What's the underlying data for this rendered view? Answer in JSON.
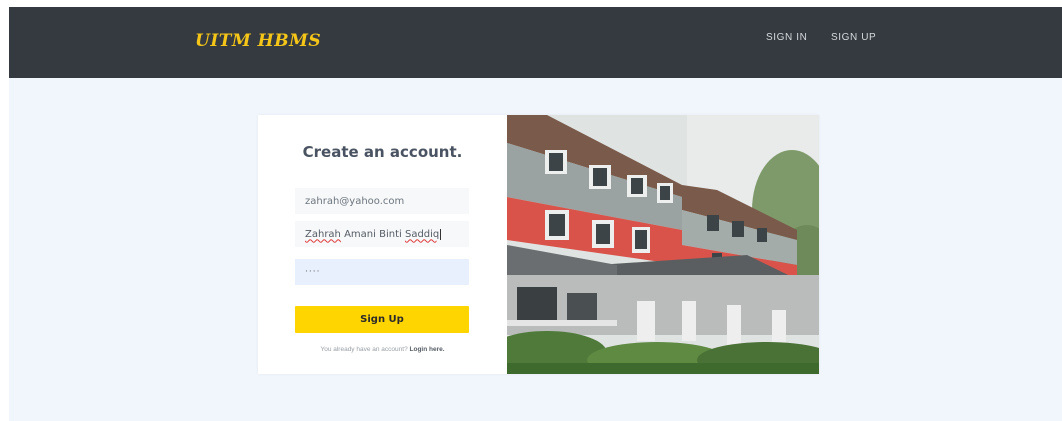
{
  "navbar": {
    "brand": "UITM HBMS",
    "links": [
      {
        "label": "SIGN IN"
      },
      {
        "label": "SIGN UP"
      }
    ]
  },
  "form": {
    "title": "Create an account.",
    "email_value": "zahrah@yahoo.com",
    "name_value_parts": [
      "Zahrah",
      "Amani Binti",
      "Saddiq"
    ],
    "password_mask": "····",
    "submit_label": "Sign Up",
    "login_prompt": "You already have an account?",
    "login_link": "Login here."
  },
  "colors": {
    "navbar_bg": "#343a40",
    "brand": "#f5c518",
    "button": "#ffd500",
    "page_bg": "#f1f6fc"
  }
}
